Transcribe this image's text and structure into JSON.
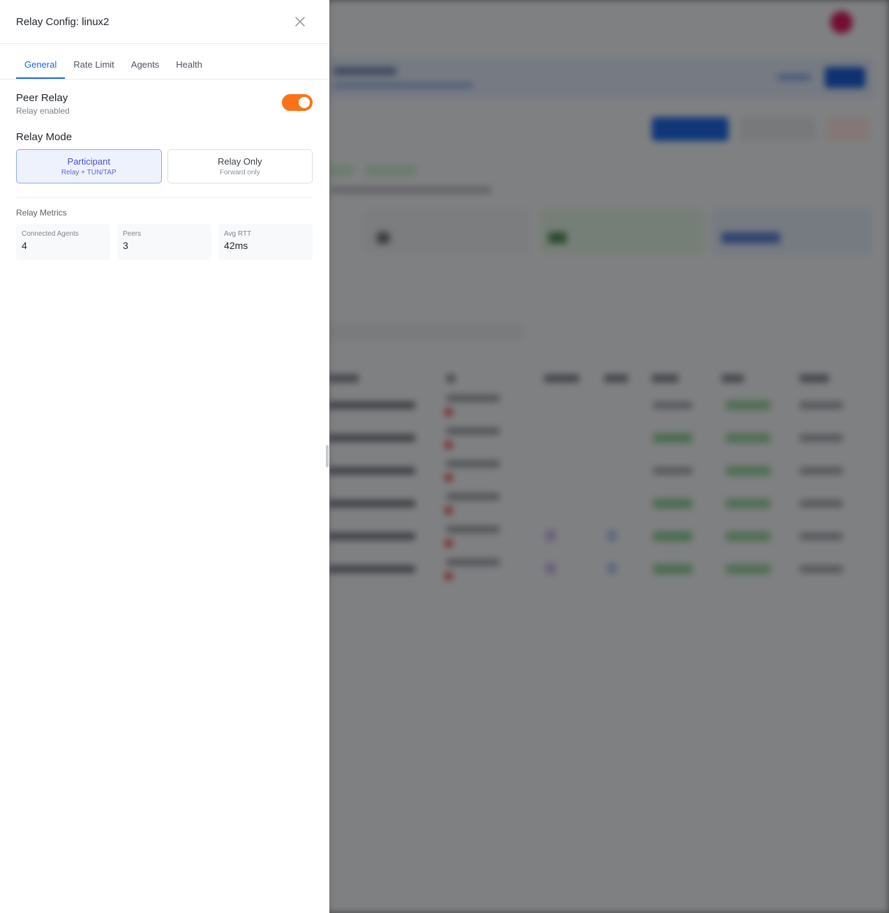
{
  "drawer": {
    "title": "Relay Config: linux2",
    "tabs": [
      {
        "label": "General",
        "active": true
      },
      {
        "label": "Rate Limit",
        "active": false
      },
      {
        "label": "Agents",
        "active": false
      },
      {
        "label": "Health",
        "active": false
      }
    ],
    "peer_relay": {
      "title": "Peer Relay",
      "status": "Relay enabled",
      "enabled": true,
      "toggle_color": "#f97316"
    },
    "relay_mode": {
      "title": "Relay Mode",
      "options": [
        {
          "name": "Participant",
          "desc": "Relay + TUN/TAP",
          "selected": true
        },
        {
          "name": "Relay Only",
          "desc": "Forward only",
          "selected": false
        }
      ]
    },
    "metrics": {
      "title": "Relay Metrics",
      "items": [
        {
          "label": "Connected Agents",
          "value": "4"
        },
        {
          "label": "Peers",
          "value": "3"
        },
        {
          "label": "Avg RTT",
          "value": "42ms"
        }
      ]
    }
  },
  "colors": {
    "accent": "#1d66e0",
    "selected_mode_border": "#8fa8ea",
    "selected_mode_bg": "#eef2fd"
  }
}
